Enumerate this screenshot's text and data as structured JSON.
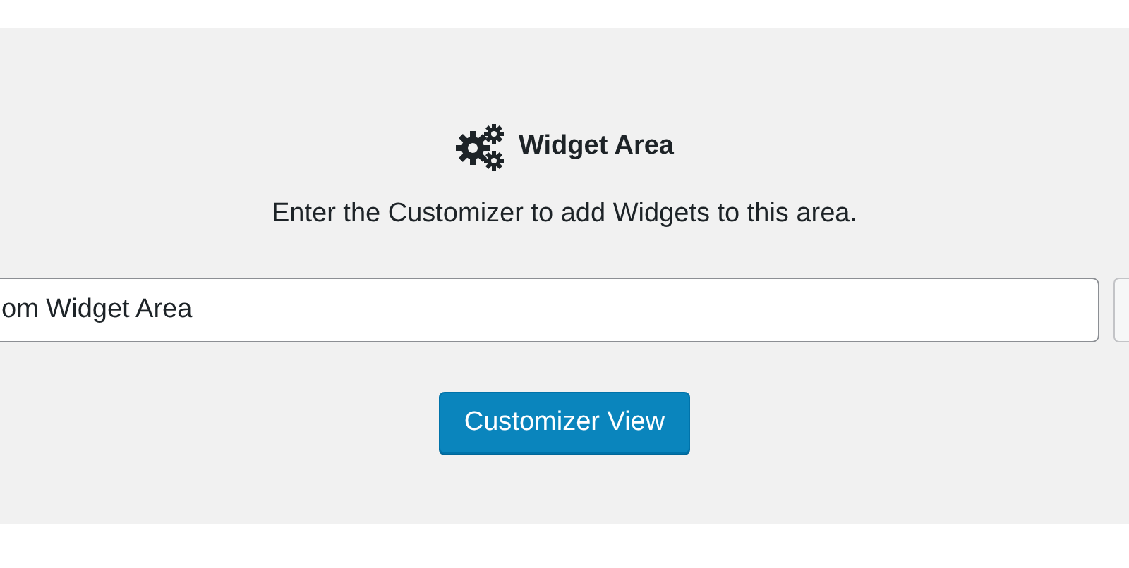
{
  "panel": {
    "title": "Widget Area",
    "description": "Enter the Customizer to add Widgets to this area."
  },
  "field": {
    "value": "om Widget Area"
  },
  "button": {
    "label": "Customizer View"
  }
}
